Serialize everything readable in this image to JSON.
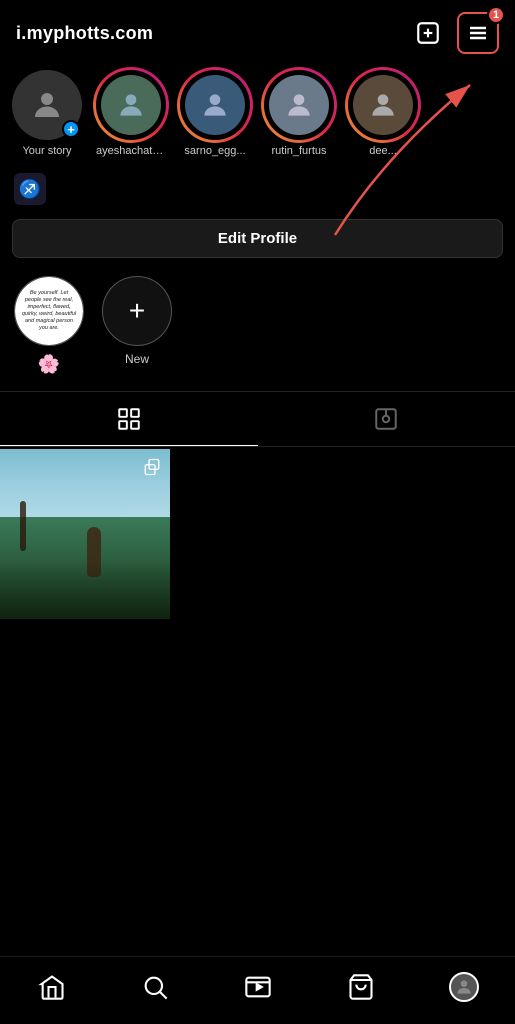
{
  "header": {
    "username": "i.myphotts.com",
    "add_icon_label": "add-content-icon",
    "menu_icon_label": "menu-icon",
    "notification_count": "1"
  },
  "stories": [
    {
      "id": "your-story",
      "label": "Your story",
      "has_add": true,
      "has_ring": false
    },
    {
      "id": "story-1",
      "label": "ayeshachathi...",
      "has_add": false,
      "has_ring": true
    },
    {
      "id": "story-2",
      "label": "sarno_egg...",
      "has_add": false,
      "has_ring": true
    },
    {
      "id": "story-3",
      "label": "rutin_furtus",
      "has_add": false,
      "has_ring": true
    },
    {
      "id": "story-4",
      "label": "dee...",
      "has_add": false,
      "has_ring": true
    }
  ],
  "zodiac_icon": "♐",
  "edit_profile_label": "Edit Profile",
  "highlights": [
    {
      "id": "highlight-1",
      "label": "",
      "type": "quote"
    },
    {
      "id": "highlight-new",
      "label": "New",
      "type": "new"
    }
  ],
  "tabs": [
    {
      "id": "grid",
      "label": "grid-view",
      "active": true
    },
    {
      "id": "tagged",
      "label": "tagged-view",
      "active": false
    }
  ],
  "posts": [
    {
      "id": "post-1",
      "has_copy_icon": true
    }
  ],
  "bottom_nav": {
    "items": [
      {
        "id": "home",
        "label": "Home"
      },
      {
        "id": "search",
        "label": "Search"
      },
      {
        "id": "reels",
        "label": "Reels"
      },
      {
        "id": "shop",
        "label": "Shop"
      },
      {
        "id": "profile",
        "label": "Profile"
      }
    ]
  },
  "quote_text": "Be yourself. Let people see the real, imperfect, flawed, quirky, weird, beautiful and magical person you are."
}
